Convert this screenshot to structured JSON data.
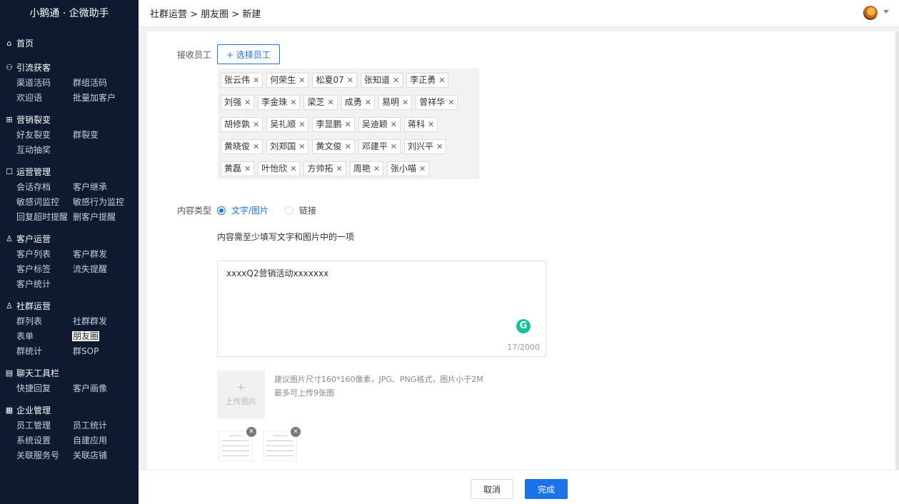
{
  "sidebar": {
    "brand": "小鹅通 · 企微助手",
    "home": {
      "label": "首页",
      "icon": "home-icon"
    },
    "groups": [
      {
        "title": "引流获客",
        "icon": "network-icon",
        "items": [
          "渠道活码",
          "群组活码",
          "欢迎语",
          "批量加客户"
        ]
      },
      {
        "title": "营销裂变",
        "icon": "fission-icon",
        "items": [
          "好友裂变",
          "群裂变",
          "互动抽奖"
        ]
      },
      {
        "title": "运营管理",
        "icon": "chat-icon",
        "items": [
          "会话存档",
          "客户继承",
          "敏感词监控",
          "敏感行为监控",
          "回复超时提醒",
          "删客户提醒"
        ]
      },
      {
        "title": "客户运营",
        "icon": "user-icon",
        "items": [
          "客户列表",
          "客户群发",
          "客户标签",
          "流失提醒",
          "客户统计"
        ]
      },
      {
        "title": "社群运营",
        "icon": "group-icon",
        "items": [
          "群列表",
          "社群群发",
          "表单",
          "朋友圈",
          "群统计",
          "群SOP"
        ]
      },
      {
        "title": "聊天工具栏",
        "icon": "toolbar-icon",
        "items": [
          "快捷回复",
          "客户画像"
        ]
      },
      {
        "title": "企业管理",
        "icon": "building-icon",
        "items": [
          "员工管理",
          "员工统计",
          "系统设置",
          "自建应用",
          "关联服务号",
          "关联店铺"
        ]
      }
    ],
    "active_item": "朋友圈"
  },
  "topbar": {
    "breadcrumb": "社群运营 > 朋友圈 > 新建"
  },
  "form": {
    "receivers_label": "接收员工",
    "select_button": "+ 选择员工",
    "tag_rows": [
      [
        "张云伟",
        "何荣生",
        "松夏07",
        "张知道",
        "李正勇"
      ],
      [
        "刘强",
        "李金珠",
        "梁芝",
        "成勇",
        "易明",
        "曾祥华"
      ],
      [
        "胡修孰",
        "吴礼顺",
        "李显鹏",
        "吴迪颖",
        "蒋科"
      ],
      [
        "黄晓俊",
        "刘郑国",
        "黄文俊",
        "邓建平",
        "刘兴平"
      ],
      [
        "黄磊",
        "叶怡欣",
        "方帅拓",
        "周艳",
        "张小喵"
      ]
    ],
    "content_type_label": "内容类型",
    "content_type_options": [
      "文字/图片",
      "链接"
    ],
    "content_type_selected": "文字/图片",
    "hint": "内容需至少填写文字和图片中的一项",
    "text_value": "xxxxQ2营销活动xxxxxxx",
    "counter": "17/2000",
    "upload_label": "上传图片",
    "upload_hint_1": "建议图片尺寸160*160像素，JPG、PNG格式，图片小于2M",
    "upload_hint_2": "最多可上传9张图"
  },
  "footer": {
    "cancel": "取消",
    "ok": "完成"
  },
  "colors": {
    "sidebar_bg": "#0e1a30",
    "accent": "#1a73e8"
  }
}
